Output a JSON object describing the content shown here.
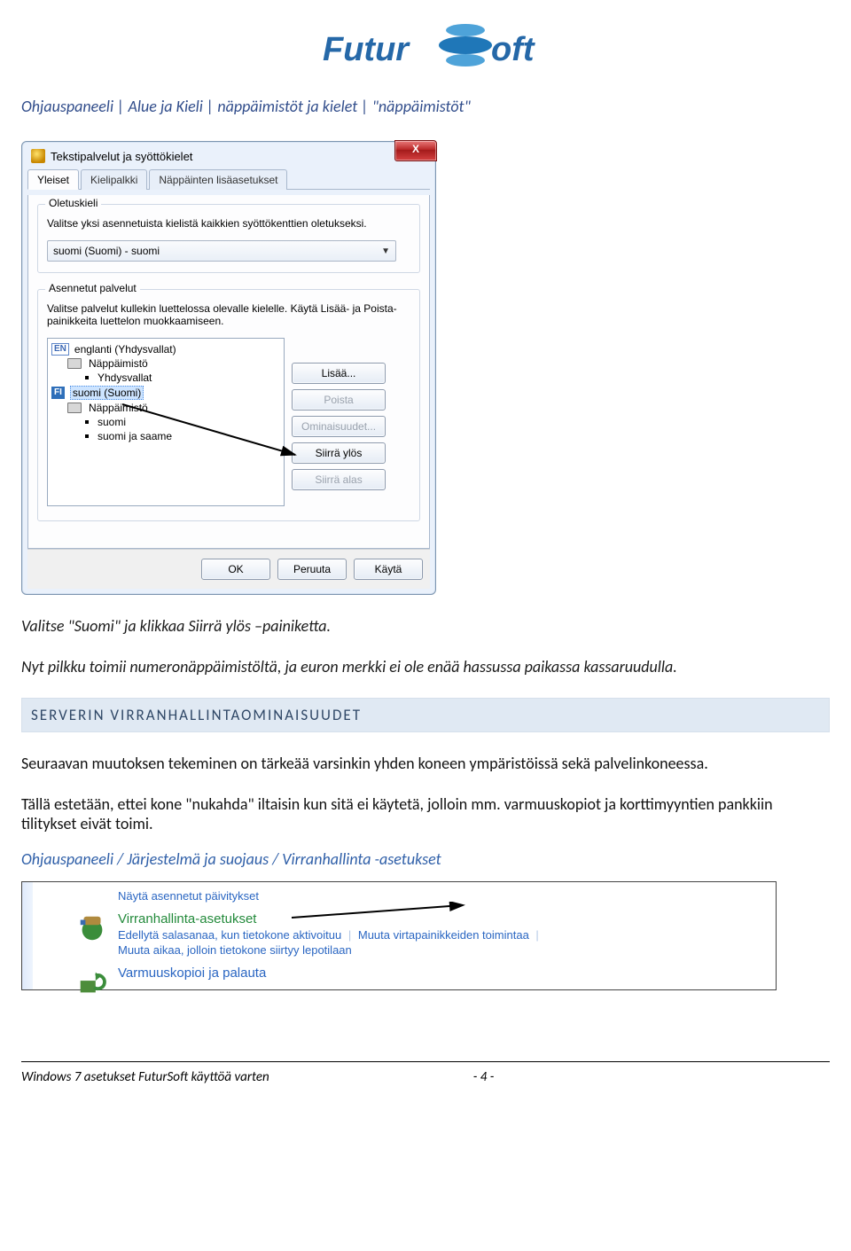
{
  "logo_text_left": "Futur",
  "logo_text_right": "oft",
  "breadcrumb": "Ohjauspaneeli | Alue ja Kieli | näppäimistöt ja kielet | \"näppäimistöt\"",
  "dialog": {
    "title": "Tekstipalvelut ja syöttökielet",
    "close_label": "X",
    "tabs": {
      "general": "Yleiset",
      "langbar": "Kielipalkki",
      "advkeys": "Näppäinten lisäasetukset"
    },
    "group_default": {
      "title": "Oletuskieli",
      "desc": "Valitse yksi asennetuista kielistä kaikkien syöttökenttien oletukseksi.",
      "combo_value": "suomi (Suomi) - suomi"
    },
    "group_services": {
      "title": "Asennetut palvelut",
      "desc": "Valitse palvelut kullekin luettelossa olevalle kielelle. Käytä Lisää- ja Poista-painikkeita luettelon muokkaamiseen.",
      "en_code": "EN",
      "en_label": "englanti (Yhdysvallat)",
      "kb_label": "Näppäimistö",
      "en_kb_item": "Yhdysvallat",
      "fi_code": "FI",
      "fi_label": "suomi (Suomi)",
      "fi_kb_item1": "suomi",
      "fi_kb_item2": "suomi ja saame",
      "btn_add": "Lisää...",
      "btn_remove": "Poista",
      "btn_props": "Ominaisuudet...",
      "btn_up": "Siirrä ylös",
      "btn_down": "Siirrä alas"
    },
    "buttons": {
      "ok": "OK",
      "cancel": "Peruuta",
      "apply": "Käytä"
    }
  },
  "para1": "Valitse \"Suomi\"  ja klikkaa Siirrä ylös –painiketta.",
  "para2": "Nyt pilkku toimii numeronäppäimistöltä, ja euron merkki ei ole enää hassussa paikassa kassaruudulla.",
  "section_heading": "SERVERIN VIRRANHALLINTAOMINAISUUDET",
  "para3": "Seuraavan muutoksen tekeminen on tärkeää varsinkin yhden koneen ympäristöissä sekä palvelinkoneessa.",
  "para4": "Tällä estetään, ettei kone \"nukahda\" iltaisin kun sitä ei käytetä, jolloin mm. varmuuskopiot ja korttimyyntien pankkiin tilitykset eivät toimi.",
  "blue_path": "Ohjauspaneeli /  Järjestelmä ja suojaus / Virranhallinta -asetukset",
  "cp": {
    "line0": "Näytä asennetut päivitykset",
    "power_title": "Virranhallinta-asetukset",
    "power_sub1": "Edellytä salasanaa, kun tietokone aktivoituu",
    "power_sub2": "Muuta virtapainikkeiden toimintaa",
    "power_sub3": "Muuta aikaa, jolloin tietokone siirtyy lepotilaan",
    "backup_title": "Varmuuskopioi ja palauta"
  },
  "footer": {
    "left": "Windows 7 asetukset FuturSoft käyttöä varten",
    "right": "- 4 -"
  }
}
